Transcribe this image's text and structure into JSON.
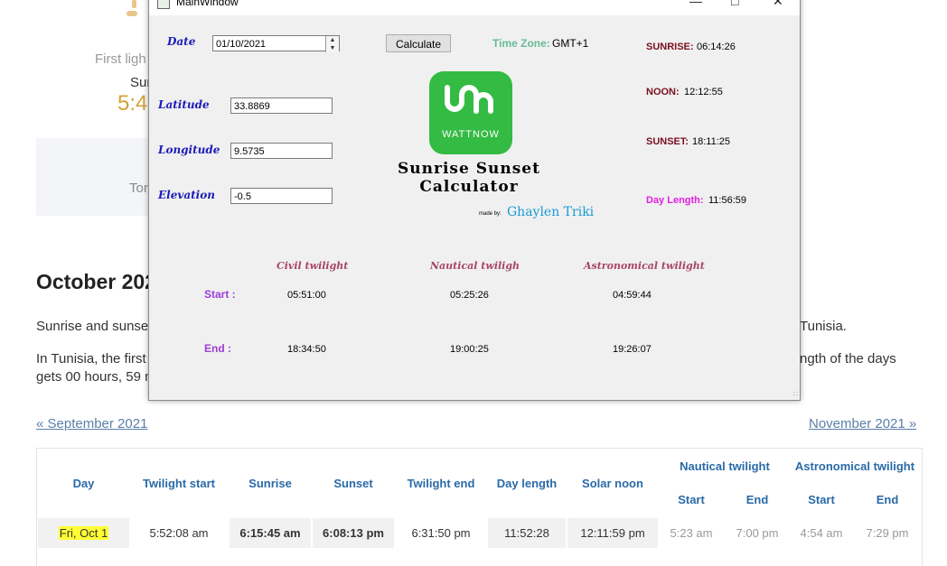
{
  "background_page": {
    "first_light_fragment": "First ligh",
    "sunrise_fragment": "Sur",
    "time_fragment": "5:4",
    "tomorrow_fragment": "Tor",
    "heading": "October 202",
    "paragraph1_left": "Sunrise and sunse",
    "paragraph1_right": "Tunisia.",
    "paragraph2_left": "In Tunisia, the first",
    "paragraph2_right": "ngth of the days",
    "paragraph3": "gets 00 hours, 59 m",
    "prev_link": "« September 2021",
    "next_link": "November 2021 »",
    "table": {
      "headers": [
        "Day",
        "Twilight start",
        "Sunrise",
        "Sunset",
        "Twilight end",
        "Day length",
        "Solar noon"
      ],
      "group_headers": [
        "Nautical twilight",
        "Astronomical twilight"
      ],
      "sub_headers": [
        "Start",
        "End",
        "Start",
        "End"
      ],
      "row": [
        "Fri, Oct 1",
        "5:52:08 am",
        "6:15:45 am",
        "6:08:13 pm",
        "6:31:50 pm",
        "11:52:28",
        "12:11:59 pm",
        "5:23 am",
        "7:00 pm",
        "4:54 am",
        "7:29 pm"
      ]
    }
  },
  "window": {
    "title": "MainWindow",
    "date_label": "Date",
    "date_value": "01/10/2021",
    "latitude_label": "Latitude",
    "latitude_value": "33.8869",
    "longitude_label": "Longitude",
    "longitude_value": "9.5735",
    "elevation_label": "Elevation",
    "elevation_value": "-0.5",
    "calculate_label": "Calculate",
    "timezone_label": "Time Zone:",
    "timezone_value": "GMT+1",
    "sunrise_label": "SUNRISE:",
    "sunrise_value": "06:14:26",
    "noon_label": "NOON:",
    "noon_value": "12:12:55",
    "sunset_label": "SUNSET:",
    "sunset_value": "18:11:25",
    "daylength_label": "Day Length:",
    "daylength_value": "11:56:59",
    "logo_word": "WATTNOW",
    "brand_line1": "Sunrise Sunset",
    "brand_line2": "Calculator",
    "made_by": "made by:",
    "author": "Ghaylen Triki",
    "twilight_headers": [
      "Civil twilight",
      "Nautical twiligh",
      "Astronomical twilight"
    ],
    "start_label": "Start :",
    "end_label": "End :",
    "start_values": [
      "05:51:00",
      "05:25:26",
      "04:59:44"
    ],
    "end_values": [
      "18:34:50",
      "19:00:25",
      "19:26:07"
    ]
  },
  "colors": {
    "logo_green": "#33bb44",
    "label_blue": "#1b1bb8",
    "sun_red": "#7a1020",
    "daylength_magenta": "#e020e0",
    "author_blue": "#1a9ad6",
    "highlight": "#ffff33"
  }
}
